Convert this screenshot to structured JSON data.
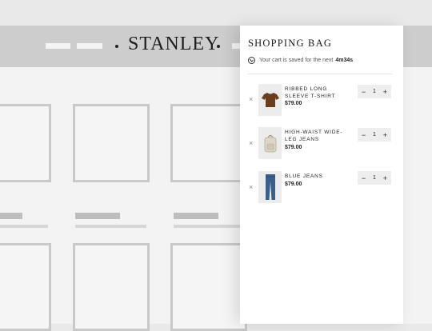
{
  "store": {
    "brand": "STANLEY"
  },
  "cart": {
    "title": "SHOPPING BAG",
    "saved_text": "Your cart is saved for the next",
    "saved_time": "4m34s",
    "items": [
      {
        "name": "RIBBED LONG SLEEVE T-SHIRT",
        "price": "$79.00",
        "quantity": "1",
        "minus": "−",
        "plus": "+",
        "remove": "×",
        "icon": "tshirt-icon",
        "color": "#6b3d1f"
      },
      {
        "name": "HIGH-WAIST WIDE-LEG JEANS",
        "price": "$79.00",
        "quantity": "1",
        "minus": "−",
        "plus": "+",
        "remove": "×",
        "icon": "backpack-icon",
        "color": "#d9d4c4"
      },
      {
        "name": "BLUE JEANS",
        "price": "$79.00",
        "quantity": "1",
        "minus": "−",
        "plus": "+",
        "remove": "×",
        "icon": "jeans-icon",
        "color": "#3a5f8a"
      }
    ]
  }
}
